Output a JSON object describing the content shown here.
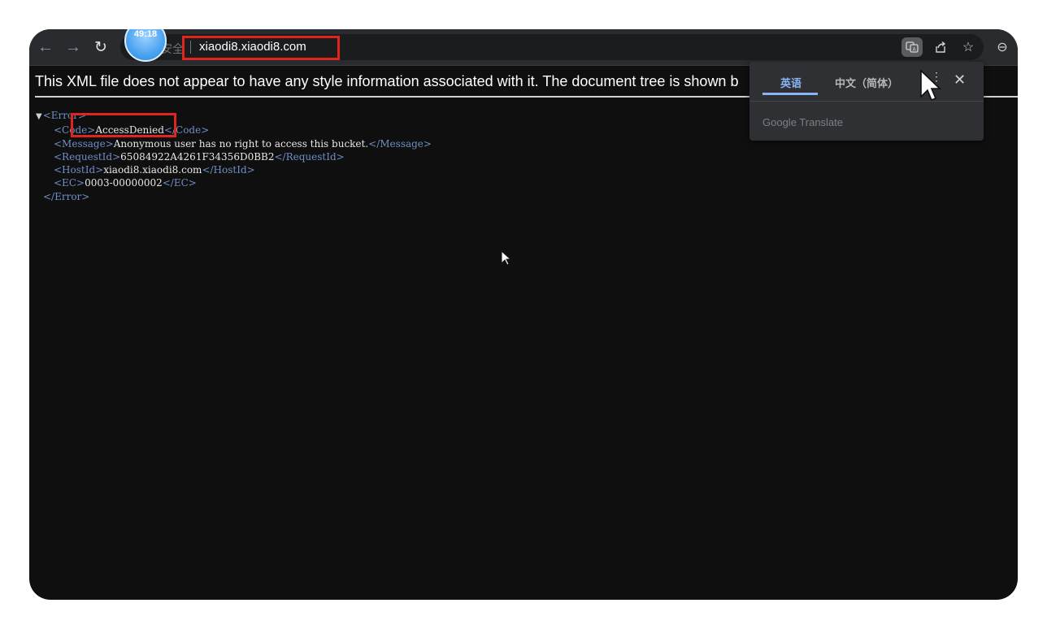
{
  "browser": {
    "timer": "49:18",
    "security_label": "安全",
    "url": "xiaodi8.xiaodi8.com"
  },
  "page": {
    "banner": "This XML file does not appear to have any style information associated with it. The document tree is shown b",
    "xml": {
      "root_open": "<Error>",
      "root_close": "</Error>",
      "entries": [
        {
          "open": "<Code>",
          "value": "AccessDenied",
          "close": "</Code>"
        },
        {
          "open": "<Message>",
          "value": "Anonymous user has no right to access this bucket.",
          "close": "</Message>"
        },
        {
          "open": "<RequestId>",
          "value": "65084922A4261F34356D0BB2",
          "close": "</RequestId>"
        },
        {
          "open": "<HostId>",
          "value": "xiaodi8.xiaodi8.com",
          "close": "</HostId>"
        },
        {
          "open": "<EC>",
          "value": "0003-00000002",
          "close": "</EC>"
        }
      ]
    }
  },
  "translate_popup": {
    "tab_source": "英语",
    "tab_target": "中文（简体）",
    "brand": "Google Translate"
  },
  "colors": {
    "highlight": "#e0251c",
    "tag": "#6f8fc5",
    "accent": "#8ab4f8"
  }
}
